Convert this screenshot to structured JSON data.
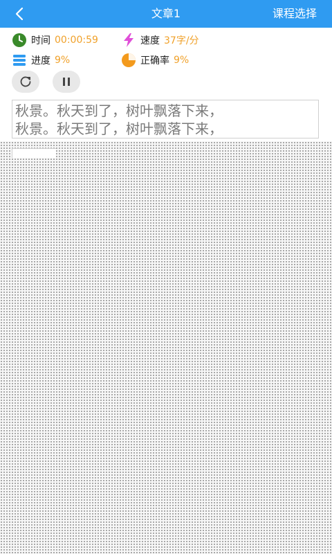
{
  "header": {
    "title": "文章1",
    "course_select": "课程选择"
  },
  "stats": {
    "time": {
      "label": "时间",
      "value": "00:00:59",
      "icon": "clock-icon",
      "color": "#3a8a2a"
    },
    "speed": {
      "label": "速度",
      "value": "37字/分",
      "icon": "lightning-icon",
      "color": "#e04fd8"
    },
    "progress": {
      "label": "进度",
      "value": "9%",
      "icon": "stack-icon",
      "color": "#2f9bf1"
    },
    "accuracy": {
      "label": "正确率",
      "value": "9%",
      "icon": "pie-chart-icon",
      "color": "#f39a1d"
    }
  },
  "controls": {
    "restart": {
      "icon": "refresh-icon"
    },
    "pause": {
      "icon": "pause-icon"
    }
  },
  "article": {
    "line1": "秋景。秋天到了，树叶飘落下来，",
    "line2": "秋景。秋天到了，树叶飘落下来，"
  },
  "colors": {
    "header_bg": "#2f9bf1",
    "value_text": "#f0a12a"
  }
}
